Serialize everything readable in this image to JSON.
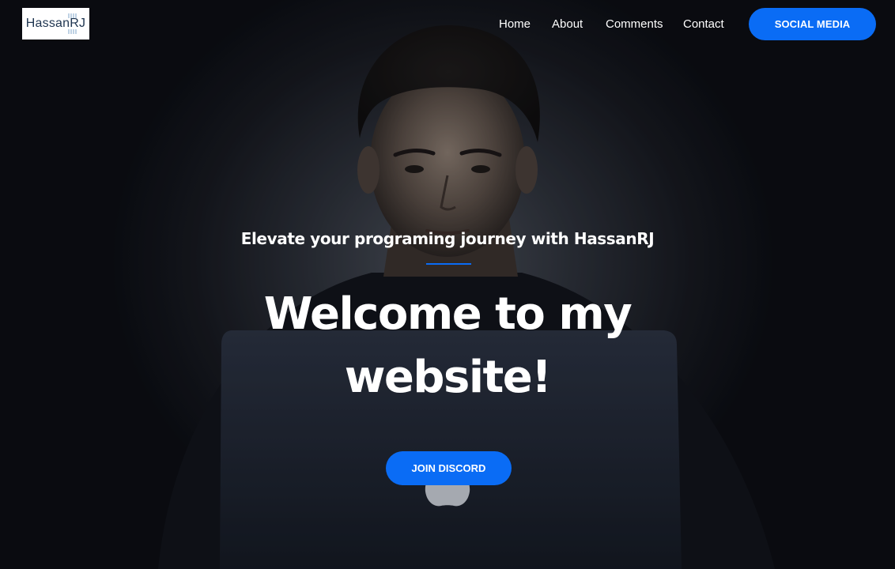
{
  "brand": {
    "logo_text": "HassanRJ"
  },
  "nav": {
    "items": [
      {
        "label": "Home"
      },
      {
        "label": "About"
      },
      {
        "label": "Comments"
      },
      {
        "label": "Contact"
      }
    ],
    "social_button": "SOCIAL MEDIA"
  },
  "hero": {
    "subtitle": "Elevate your programing journey with HassanRJ",
    "headline": "Welcome to my website!",
    "cta_button": "JOIN DISCORD"
  },
  "colors": {
    "accent": "#0a6cf5",
    "background": "#0b0c12",
    "text": "#ffffff"
  },
  "icons": [
    "person-at-laptop-photo",
    "apple-logo-icon"
  ]
}
